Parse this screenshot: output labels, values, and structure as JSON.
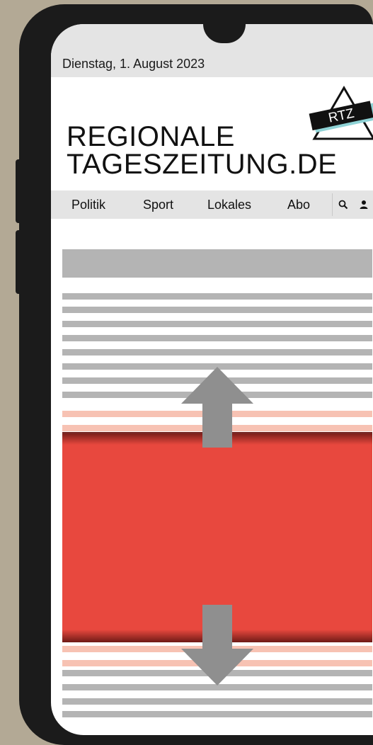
{
  "status_bar": {
    "date": "Dienstag, 1. August 2023"
  },
  "header": {
    "brand_line1": "REGIONALE",
    "brand_line2": "TAGESZEITUNG.DE",
    "logo_text": "RTZ"
  },
  "nav": {
    "items": [
      {
        "label": "Politik"
      },
      {
        "label": "Sport"
      },
      {
        "label": "Lokales"
      },
      {
        "label": "Abo"
      }
    ],
    "icons": [
      "search-icon",
      "user-icon"
    ]
  },
  "colors": {
    "background": "#b3a995",
    "phone_frame": "#1b1b1b",
    "bar_gray": "#e4e4e4",
    "placeholder_gray": "#b4b4b4",
    "ad_red": "#e8483e",
    "ad_pink_lines": "#f7c2b3",
    "arrow_gray": "#8f8f8f",
    "logo_accent": "#8fd3d6"
  }
}
